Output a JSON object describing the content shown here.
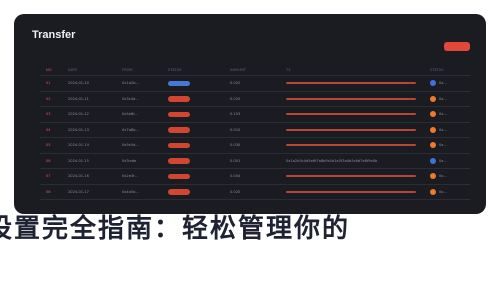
{
  "window": {
    "title": "Transfer",
    "action_label": ""
  },
  "table": {
    "headers": [
      "NO",
      "DATE",
      "FROM",
      "STATUS",
      "AMOUNT",
      "TX",
      "STATUS"
    ],
    "rows": [
      {
        "no": "01",
        "date": "2024-01-10",
        "from": "0x1a2b...",
        "status": "",
        "status_color": "#4778d6",
        "amount": "0.002",
        "desc_text": "",
        "has_bar": true,
        "dot": "blue",
        "flag": "0x..."
      },
      {
        "no": "02",
        "date": "2024-01-11",
        "from": "0x3c4d...",
        "status": "",
        "status_color": "#d2452f",
        "amount": "0.020",
        "desc_text": "",
        "has_bar": true,
        "dot": "orange",
        "flag": "0x..."
      },
      {
        "no": "03",
        "date": "2024-01-12",
        "from": "0x5e6f...",
        "status": "",
        "status_color": "#d2452f",
        "amount": "0.153",
        "desc_text": "",
        "has_bar": true,
        "dot": "orange",
        "flag": "0x..."
      },
      {
        "no": "04",
        "date": "2024-01-13",
        "from": "0x7a8b...",
        "status": "",
        "status_color": "#d2452f",
        "amount": "0.010",
        "desc_text": "",
        "has_bar": true,
        "dot": "orange",
        "flag": "0x..."
      },
      {
        "no": "05",
        "date": "2024-01-14",
        "from": "0x9c0d...",
        "status": "",
        "status_color": "#d2452f",
        "amount": "0.030",
        "desc_text": "",
        "has_bar": true,
        "dot": "orange",
        "flag": "0x..."
      },
      {
        "no": "06",
        "date": "2024-01-15",
        "from": "0xTrade",
        "status": "",
        "status_color": "#d2452f",
        "amount": "0.001",
        "desc_text": "0x1a2b3c4d5e6f7a8b9c0d1e2f3a4b5c6d7e8f9a0b",
        "has_bar": false,
        "dot": "blue",
        "flag": "0x..."
      },
      {
        "no": "07",
        "date": "2024-01-16",
        "from": "0x2e3f...",
        "status": "",
        "status_color": "#d2452f",
        "amount": "0.004",
        "desc_text": "",
        "has_bar": true,
        "dot": "orange",
        "flag": "0x..."
      },
      {
        "no": "08",
        "date": "2024-01-17",
        "from": "0x4a5b...",
        "status": "",
        "status_color": "#d2452f",
        "amount": "0.020",
        "desc_text": "",
        "has_bar": true,
        "dot": "orange",
        "flag": "0x..."
      }
    ]
  },
  "caption": {
    "text": "设置完全指南：轻松管理你的"
  }
}
